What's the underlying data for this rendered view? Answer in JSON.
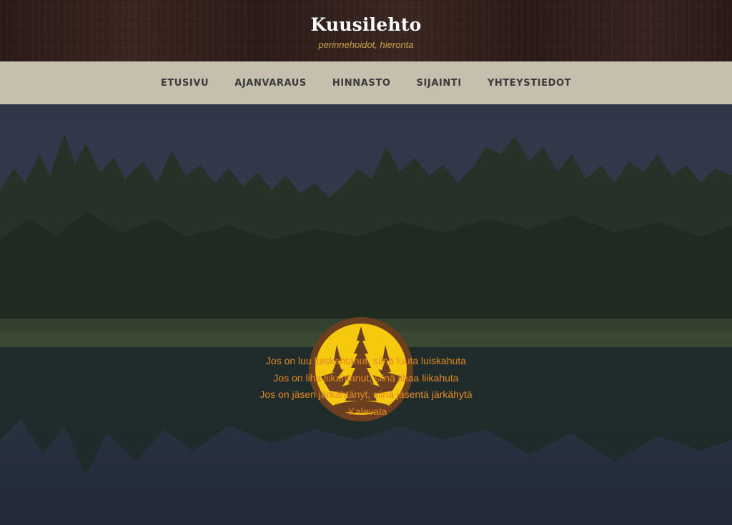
{
  "header": {
    "site_title": "Kuusilehto",
    "tagline": "perinnehoidot, hieronta"
  },
  "nav": {
    "items": [
      {
        "label": "ETUSIVU"
      },
      {
        "label": "AJANVARAUS"
      },
      {
        "label": "HINNASTO"
      },
      {
        "label": "SIJAINTI"
      },
      {
        "label": "YHTEYSTIEDOT"
      }
    ]
  },
  "hero": {
    "logo_icon": "spruce-tree-emblem-icon",
    "quote_lines": [
      "Jos on luu luiskahtanut, siinä luuta luiskahuta",
      "Jos on liha liikahtanut, siinä lihaa liikahuta",
      "Jos on jäsen järkähtänyt, siinä jäsentä järkähytä",
      "-Kalevala"
    ]
  },
  "colors": {
    "nav_background": "#c7bfad",
    "tagline": "#c9a24a",
    "quote_text": "#e28a24",
    "logo_yellow": "#f6c90e",
    "logo_brown": "#6b3f1f"
  }
}
